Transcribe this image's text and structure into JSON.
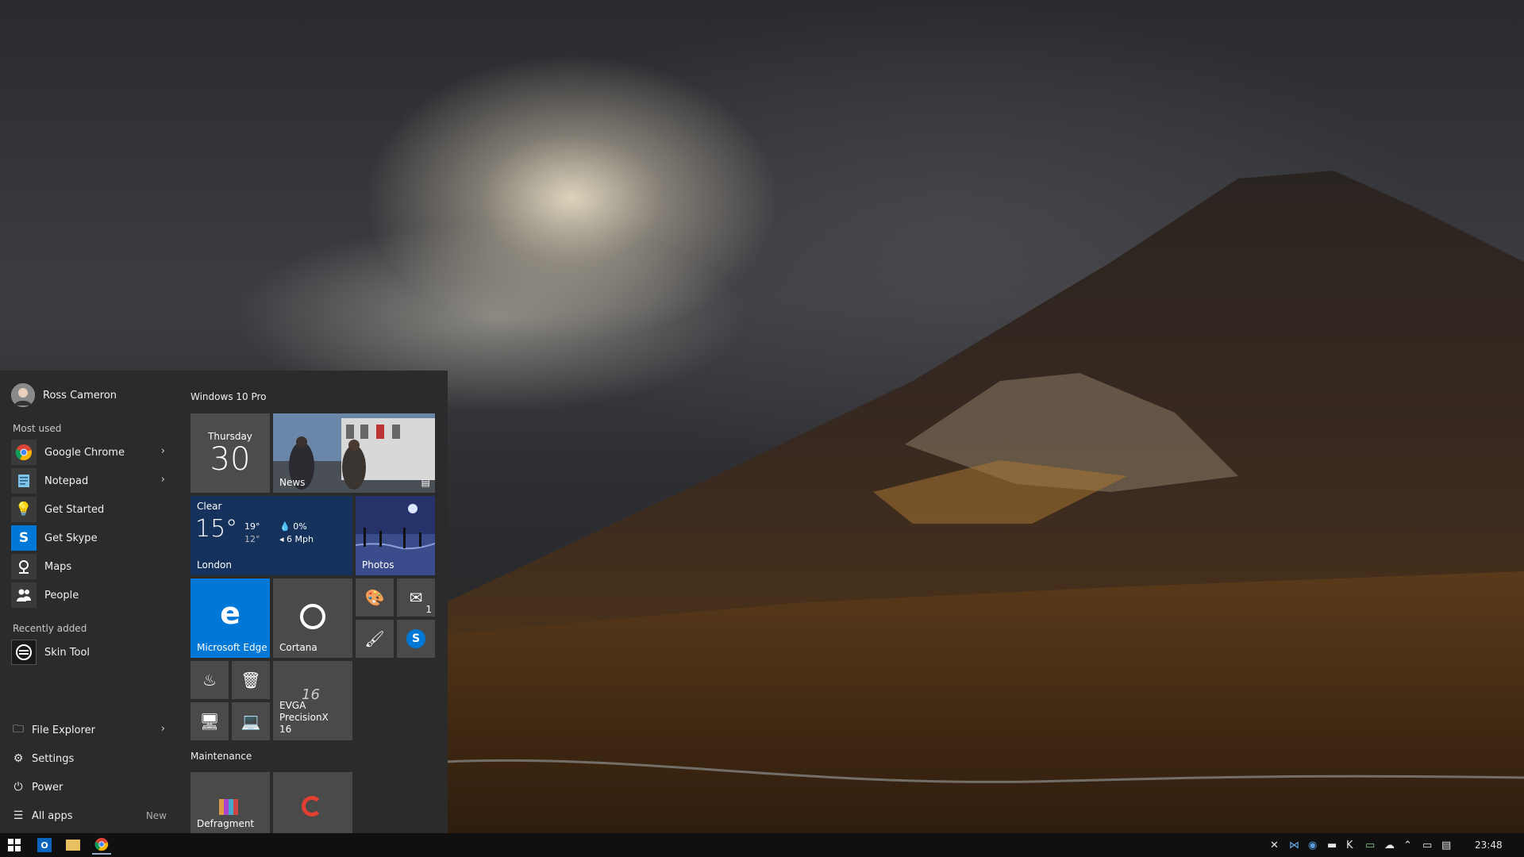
{
  "user": {
    "name": "Ross Cameron"
  },
  "sections": {
    "most_used": "Most used",
    "recently_added": "Recently added",
    "group1": "Windows 10 Pro",
    "group2": "Maintenance"
  },
  "most_used": [
    {
      "label": "Google Chrome",
      "icon": "chrome-icon",
      "has_submenu": true
    },
    {
      "label": "Notepad",
      "icon": "notepad-icon",
      "has_submenu": true
    },
    {
      "label": "Get Started",
      "icon": "lightbulb-icon",
      "has_submenu": false
    },
    {
      "label": "Get Skype",
      "icon": "skype-icon",
      "has_submenu": false
    },
    {
      "label": "Maps",
      "icon": "maps-icon",
      "has_submenu": false
    },
    {
      "label": "People",
      "icon": "people-icon",
      "has_submenu": false
    }
  ],
  "recently_added": [
    {
      "label": "Skin Tool",
      "icon": "skin-tool-icon"
    }
  ],
  "system": {
    "file_explorer": "File Explorer",
    "settings": "Settings",
    "power": "Power",
    "all_apps": "All apps",
    "new_badge": "New"
  },
  "tiles": {
    "calendar": {
      "day": "Thursday",
      "date": "30"
    },
    "news": {
      "label": "News"
    },
    "weather": {
      "condition": "Clear",
      "temp": "15°",
      "high": "19°",
      "low": "12°",
      "precip": "0%",
      "wind": "6 Mph",
      "city": "London"
    },
    "photos": {
      "label": "Photos"
    },
    "edge": {
      "label": "Microsoft Edge"
    },
    "cortana": {
      "label": "Cortana"
    },
    "mail": {
      "badge": "1"
    },
    "evga": {
      "label": "EVGA PrecisionX 16",
      "glyph": "16"
    },
    "defragment": {
      "label": "Defragment"
    }
  },
  "taskbar": {
    "clock": "23:48"
  },
  "colors": {
    "accent": "#0078d7",
    "start_bg": "#2b2b2b",
    "tile_gray": "#4a4a4a",
    "taskbar": "#101010"
  }
}
